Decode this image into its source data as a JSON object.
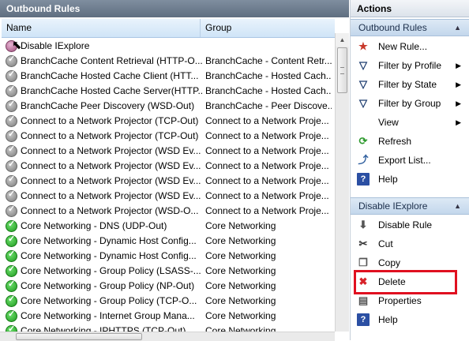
{
  "left_pane": {
    "title": "Outbound Rules",
    "columns": {
      "name": "Name",
      "group": "Group"
    },
    "rows": [
      {
        "name": "Disable IExplore",
        "group": "",
        "icon": "blocked-rule-icon"
      },
      {
        "name": "BranchCache Content Retrieval (HTTP-O...",
        "group": "BranchCache - Content Retr...",
        "icon": "disabled-rule-icon"
      },
      {
        "name": "BranchCache Hosted Cache Client (HTT...",
        "group": "BranchCache - Hosted Cach...",
        "icon": "disabled-rule-icon"
      },
      {
        "name": "BranchCache Hosted Cache Server(HTTP...",
        "group": "BranchCache - Hosted Cach...",
        "icon": "disabled-rule-icon"
      },
      {
        "name": "BranchCache Peer Discovery (WSD-Out)",
        "group": "BranchCache - Peer Discove...",
        "icon": "disabled-rule-icon"
      },
      {
        "name": "Connect to a Network Projector (TCP-Out)",
        "group": "Connect to a Network Proje...",
        "icon": "disabled-rule-icon"
      },
      {
        "name": "Connect to a Network Projector (TCP-Out)",
        "group": "Connect to a Network Proje...",
        "icon": "disabled-rule-icon"
      },
      {
        "name": "Connect to a Network Projector (WSD Ev...",
        "group": "Connect to a Network Proje...",
        "icon": "disabled-rule-icon"
      },
      {
        "name": "Connect to a Network Projector (WSD Ev...",
        "group": "Connect to a Network Proje...",
        "icon": "disabled-rule-icon"
      },
      {
        "name": "Connect to a Network Projector (WSD Ev...",
        "group": "Connect to a Network Proje...",
        "icon": "disabled-rule-icon"
      },
      {
        "name": "Connect to a Network Projector (WSD Ev...",
        "group": "Connect to a Network Proje...",
        "icon": "disabled-rule-icon"
      },
      {
        "name": "Connect to a Network Projector (WSD-O...",
        "group": "Connect to a Network Proje...",
        "icon": "disabled-rule-icon"
      },
      {
        "name": "Core Networking - DNS (UDP-Out)",
        "group": "Core Networking",
        "icon": "enabled-rule-icon"
      },
      {
        "name": "Core Networking - Dynamic Host Config...",
        "group": "Core Networking",
        "icon": "enabled-rule-icon"
      },
      {
        "name": "Core Networking - Dynamic Host Config...",
        "group": "Core Networking",
        "icon": "enabled-rule-icon"
      },
      {
        "name": "Core Networking - Group Policy (LSASS-...",
        "group": "Core Networking",
        "icon": "enabled-rule-icon"
      },
      {
        "name": "Core Networking - Group Policy (NP-Out)",
        "group": "Core Networking",
        "icon": "enabled-rule-icon"
      },
      {
        "name": "Core Networking - Group Policy (TCP-O...",
        "group": "Core Networking",
        "icon": "enabled-rule-icon"
      },
      {
        "name": "Core Networking - Internet Group Mana...",
        "group": "Core Networking",
        "icon": "enabled-rule-icon"
      },
      {
        "name": "Core Networking - IPHTTPS (TCP-Out)",
        "group": "Core Networking",
        "icon": "enabled-rule-icon"
      }
    ]
  },
  "actions_pane": {
    "title": "Actions",
    "section1": {
      "title": "Outbound Rules",
      "items": [
        {
          "label": "New Rule...",
          "icon": "new-rule-icon"
        },
        {
          "label": "Filter by Profile",
          "icon": "filter-icon",
          "submenu": true
        },
        {
          "label": "Filter by State",
          "icon": "filter-icon",
          "submenu": true
        },
        {
          "label": "Filter by Group",
          "icon": "filter-icon",
          "submenu": true
        },
        {
          "label": "View",
          "icon": "",
          "submenu": true
        },
        {
          "label": "Refresh",
          "icon": "refresh-icon"
        },
        {
          "label": "Export List...",
          "icon": "export-icon"
        },
        {
          "label": "Help",
          "icon": "help-icon"
        }
      ]
    },
    "section2": {
      "title": "Disable IExplore",
      "items": [
        {
          "label": "Disable Rule",
          "icon": "disable-rule-icon"
        },
        {
          "label": "Cut",
          "icon": "cut-icon"
        },
        {
          "label": "Copy",
          "icon": "copy-icon"
        },
        {
          "label": "Delete",
          "icon": "delete-icon"
        },
        {
          "label": "Properties",
          "icon": "properties-icon"
        },
        {
          "label": "Help",
          "icon": "help-icon"
        }
      ]
    }
  },
  "colors": {
    "highlight": "#e01020",
    "enabled": "#1f9a1f",
    "disabled": "#7c7c7c"
  }
}
